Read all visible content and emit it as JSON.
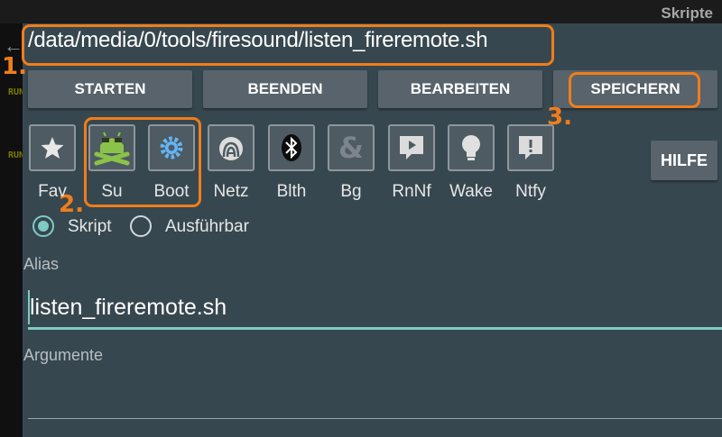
{
  "window": {
    "title": "Skripte"
  },
  "sidebar": {
    "run_label_1": "RUN",
    "run_label_2": "RUN"
  },
  "script_path": "/data/media/0/tools/firesound/listen_fireremote.sh",
  "buttons": {
    "start": "STARTEN",
    "stop": "BEENDEN",
    "edit": "BEARBEITEN",
    "save": "SPEICHERN",
    "help": "HILFE"
  },
  "options": [
    {
      "label": "Fav",
      "icon": "star-icon"
    },
    {
      "label": "Su",
      "icon": "android-skull-icon"
    },
    {
      "label": "Boot",
      "icon": "gear-icon"
    },
    {
      "label": "Netz",
      "icon": "network-icon"
    },
    {
      "label": "Blth",
      "icon": "bluetooth-icon"
    },
    {
      "label": "Bg",
      "icon": "ampersand-icon"
    },
    {
      "label": "RnNf",
      "icon": "notification-play-icon"
    },
    {
      "label": "Wake",
      "icon": "lightbulb-icon"
    },
    {
      "label": "Ntfy",
      "icon": "notification-exclamation-icon"
    }
  ],
  "script_type": {
    "selected": "Skript",
    "options": [
      "Skript",
      "Ausführbar"
    ]
  },
  "alias": {
    "label": "Alias",
    "value": "listen_fireremote.sh"
  },
  "arguments": {
    "label": "Argumente",
    "value": ""
  },
  "annotations": [
    "1.",
    "2.",
    "3."
  ],
  "colors": {
    "accent": "#80cbc4",
    "callout": "#f07d1a",
    "panel": "#37474f",
    "button": "#58636b"
  }
}
